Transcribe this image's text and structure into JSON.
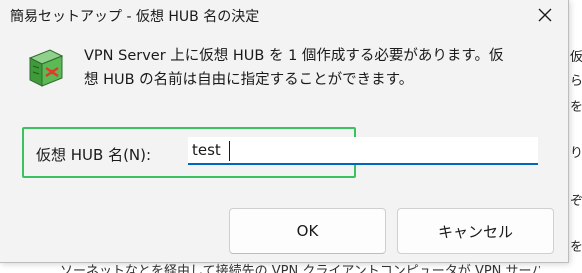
{
  "dialog": {
    "title": "簡易セットアップ - 仮想 HUB 名の決定",
    "app_icon": "vpn-hub-icon",
    "message_line1": "VPN Server 上に仮想 HUB を 1 個作成する必要があります。仮",
    "message_line2": "想 HUB の名前は自由に指定することができます。",
    "field_label": "仮想 HUB 名(N):",
    "field_value": "test",
    "ok_label": "OK",
    "cancel_label": "キャンセル",
    "close_icon": "close-icon",
    "highlight_color": "#3cc060",
    "accent_color": "#0067c0"
  },
  "background": {
    "right_glyphs": [
      "仮",
      "ら",
      "を",
      "り",
      "ぞ",
      "を"
    ],
    "bottom_text": "ソーネットなとを経由して接続先の VPN クライアントコンピュータが VPN サーバ"
  }
}
